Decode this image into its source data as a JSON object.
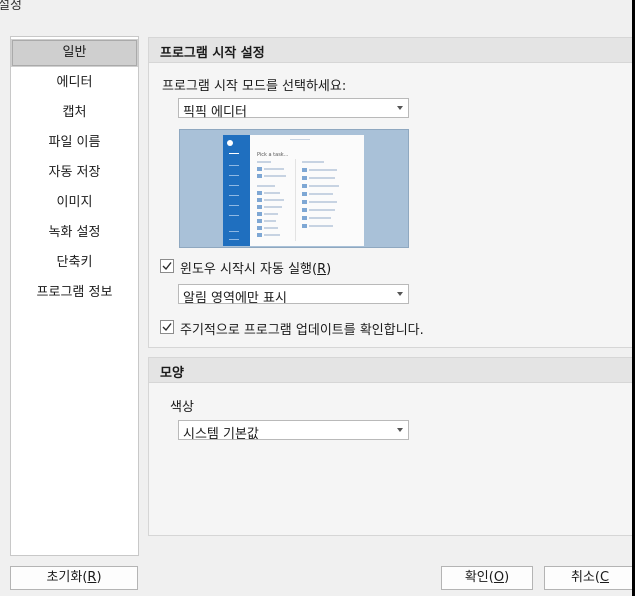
{
  "window": {
    "title": "설정"
  },
  "sidebar": {
    "items": [
      {
        "label": "일반",
        "selected": true
      },
      {
        "label": "에디터"
      },
      {
        "label": "캡처"
      },
      {
        "label": "파일 이름"
      },
      {
        "label": "자동 저장"
      },
      {
        "label": "이미지"
      },
      {
        "label": "녹화 설정"
      },
      {
        "label": "단축키"
      },
      {
        "label": "프로그램 정보"
      }
    ]
  },
  "startup": {
    "title": "프로그램 시작 설정",
    "mode_label": "프로그램 시작 모드를 선택하세요:",
    "mode_value": "픽픽 에디터",
    "preview": {
      "heading": "Pick a task..."
    },
    "autostart": {
      "label_prefix": "윈도우 시작시 자동 실행(",
      "label_key": "R",
      "label_suffix": ")",
      "checked": true
    },
    "tray_value": "알림 영역에만 표시",
    "update_check": {
      "label": "주기적으로 프로그램 업데이트를 확인합니다.",
      "checked": true
    }
  },
  "appearance": {
    "title": "모양",
    "color_label": "색상",
    "color_value": "시스템 기본값"
  },
  "buttons": {
    "reset": {
      "prefix": "초기화(",
      "key": "R",
      "suffix": ")"
    },
    "ok": {
      "prefix": "확인(",
      "key": "O",
      "suffix": ")"
    },
    "cancel": {
      "prefix": "취소(",
      "key": "C",
      "suffix": ""
    }
  }
}
